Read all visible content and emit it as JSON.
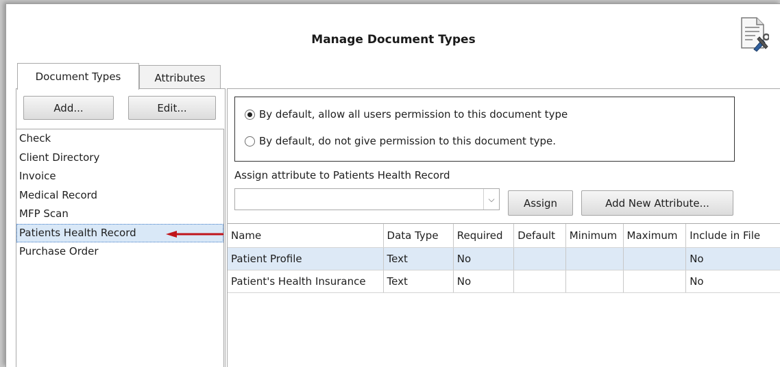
{
  "window": {
    "title": "Manage Document Types"
  },
  "tabs": [
    {
      "label": "Document Types",
      "active": true
    },
    {
      "label": "Attributes",
      "active": false
    }
  ],
  "left": {
    "add_label": "Add...",
    "edit_label": "Edit...",
    "items": [
      {
        "label": "Check"
      },
      {
        "label": "Client Directory"
      },
      {
        "label": "Invoice"
      },
      {
        "label": "Medical Record"
      },
      {
        "label": "MFP Scan"
      },
      {
        "label": "Patients Health Record",
        "selected": true
      },
      {
        "label": "Purchase Order"
      }
    ]
  },
  "right": {
    "permissions": [
      {
        "label": "By default, allow all users permission to this document type",
        "checked": true
      },
      {
        "label": "By default, do not give permission to this document type.",
        "checked": false
      }
    ],
    "assign_label": "Assign attribute to Patients Health Record",
    "combo_value": "",
    "assign_button": "Assign",
    "add_attribute_button": "Add New Attribute...",
    "table": {
      "columns": [
        "Name",
        "Data Type",
        "Required",
        "Default",
        "Minimum",
        "Maximum",
        "Include in File"
      ],
      "rows": [
        [
          "Patient Profile",
          "Text",
          "No",
          "",
          "",
          "",
          "No"
        ],
        [
          "Patient's Health Insurance",
          "Text",
          "No",
          "",
          "",
          "",
          "No"
        ]
      ]
    }
  },
  "colors": {
    "accent_arrow": "#c0151b",
    "selection": "#d9e8f7"
  }
}
